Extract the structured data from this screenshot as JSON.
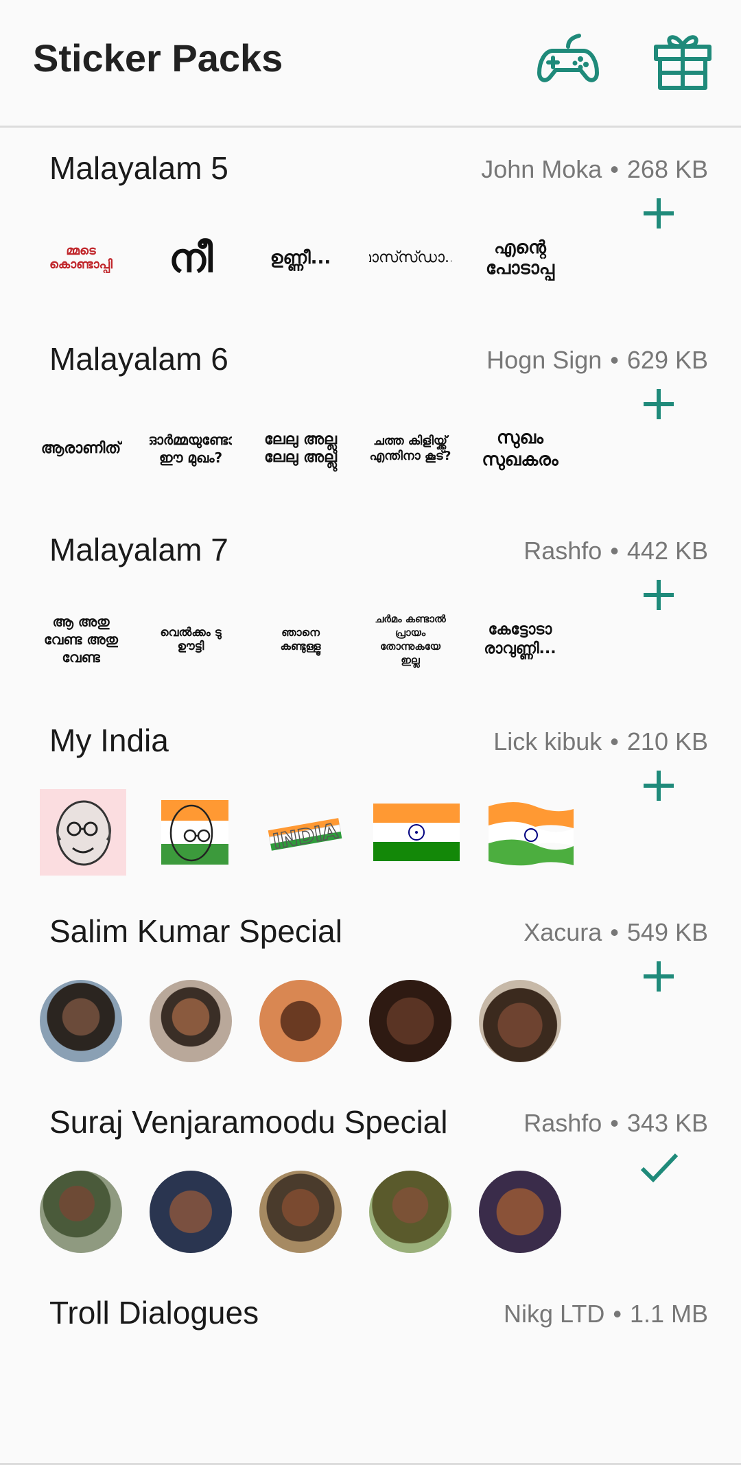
{
  "header": {
    "title": "Sticker Packs",
    "games_icon": "gamepad-icon",
    "gift_icon": "gift-icon"
  },
  "colors": {
    "accent": "#1f8a7a",
    "divider": "#dcdcdc",
    "meta_text": "#777777"
  },
  "packs": [
    {
      "name": "Malayalam 5",
      "author": "John Moka",
      "size": "268 KB",
      "status": "add",
      "stickers": [
        "മ്മടെ കൊണ്ടാപ്പി",
        "നീ",
        "ഉണ്ണീ...",
        "മാസ്സ്ഡാ...",
        "എന്റെ പോടാപ്പ"
      ]
    },
    {
      "name": "Malayalam 6",
      "author": "Hogn Sign",
      "size": "629 KB",
      "status": "add",
      "stickers": [
        "ആരാണിത്",
        "ഓർമ്മയുണ്ടോ ഈ മുഖം?",
        "ലേലു അല്ലു ലേലു അല്ലു",
        "ചത്ത കിളിയ്ക്ക് എന്തിനാ കൂട്?",
        "സുഖം സുഖകരം"
      ]
    },
    {
      "name": "Malayalam 7",
      "author": "Rashfo",
      "size": "442 KB",
      "status": "add",
      "stickers": [
        "ആ അതു വേണ്ട അതു വേണ്ട",
        "വെൽക്കം ടു ഊട്ടി",
        "ഞാനെ കണ്ടുള്ളൂ",
        "ചർമം കണ്ടാൽ പ്രായം തോന്നുകയേ ഇല്ല",
        "കേട്ടോടാ രാവുണ്ണി..."
      ]
    },
    {
      "name": "My India",
      "author": "Lick kibuk",
      "size": "210 KB",
      "status": "add",
      "stickers": [
        "gandhi-portrait",
        "gandhi-tricolor",
        "india-text",
        "india-flag",
        "india-flag-waving"
      ]
    },
    {
      "name": "Salim Kumar Special",
      "author": "Xacura",
      "size": "549 KB",
      "status": "add",
      "stickers": [
        "face-1",
        "face-2",
        "face-3",
        "face-4",
        "face-5"
      ]
    },
    {
      "name": "Suraj Venjaramoodu Special",
      "author": "Rashfo",
      "size": "343 KB",
      "status": "added",
      "stickers": [
        "face-1",
        "face-2",
        "face-3",
        "face-4",
        "face-5"
      ]
    },
    {
      "name": "Troll Dialogues",
      "author": "Nikg LTD",
      "size": "1.1 MB",
      "status": "add",
      "stickers": []
    }
  ],
  "separator": "•"
}
